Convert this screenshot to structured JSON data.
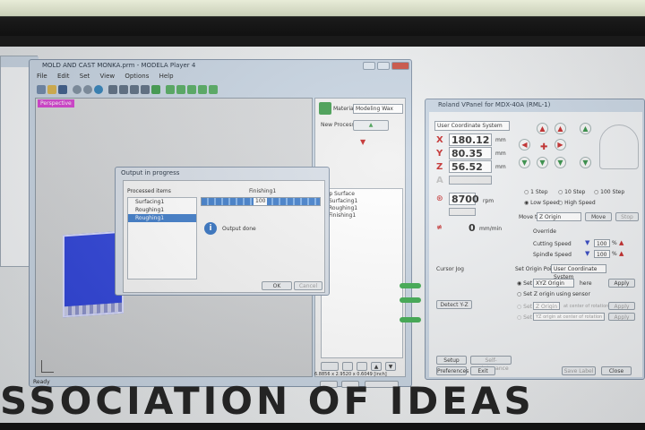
{
  "modela": {
    "title": "MOLD AND CAST MONKA.prm - MODELA Player 4",
    "menu": [
      "File",
      "Edit",
      "Set",
      "View",
      "Options",
      "Help"
    ],
    "view_label": "Perspective",
    "material_label": "Material",
    "material_value": "Modeling Wax",
    "new_process_label": "New Process",
    "tree": [
      "Top Surface",
      "Surfacing1",
      "Roughing1",
      "Finishing1"
    ],
    "status_ready": "Ready",
    "coords": "6.8856 x 2.9520 x 0.6049 [inch]"
  },
  "dialog": {
    "title": "Output in progress",
    "processed_header": "Processed items",
    "items": [
      "Surfacing1",
      "Roughing1",
      "Roughing1"
    ],
    "current_process": "Finishing1",
    "progress_value": "100",
    "progress_fraction": 1.0,
    "message": "Output done",
    "ok_label": "OK",
    "cancel_label": "Cancel"
  },
  "vpanel": {
    "title": "Roland VPanel for MDX-40A (RML-1)",
    "coord_system": "User Coordinate System",
    "x_label": "X",
    "x_value": "180.12",
    "x_unit": "mm",
    "y_label": "Y",
    "y_value": "80.35",
    "y_unit": "mm",
    "z_label": "Z",
    "z_value": "56.52",
    "z_unit": "mm",
    "a_label": "A",
    "spindle_value": "8700",
    "spindle_unit": "rpm",
    "feed_value": "0",
    "feed_unit": "mm/min",
    "step_options": [
      "1 Step",
      "10 Step",
      "100 Step"
    ],
    "speed_options": [
      "Low Speed",
      "High Speed"
    ],
    "move_to_label": "Move to",
    "move_to_value": "Z Origin",
    "move_button": "Move",
    "stop_button": "Stop",
    "override_label": "Override",
    "cutting_speed_label": "Cutting Speed",
    "cutting_speed_value": "100",
    "spindle_speed_label": "Spindle Speed",
    "spindle_speed_value": "100",
    "percent": "%",
    "cursor_jog": "Cursor Jog",
    "set_origin_label": "Set Origin Point",
    "set_origin_value": "User Coordinate System",
    "set_xy_label": "Set",
    "xyz_origin_value": "XYZ Origin",
    "here_label": "here",
    "apply_label": "Apply",
    "set_z_sensor": "Set Z origin using sensor",
    "z_origin_small": "Z Origin",
    "at_center": "at center of rotation",
    "yz_origin": "YZ origin at center of rotation",
    "detect_button": "Detect Y-Z",
    "setup_label": "Setup",
    "self_maintenance": "Self-maintenance",
    "preferences_label": "Preferences",
    "exit_label": "Exit",
    "close_label": "Close",
    "save_label": "Save Label"
  },
  "banner": {
    "text": "SSOCIATION OF IDEAS"
  },
  "colors": {
    "accent_blue": "#3b7ac9",
    "axis_red": "#c02020",
    "arrow_green": "#2b8a3e",
    "magenta_label": "#d63fd1"
  }
}
